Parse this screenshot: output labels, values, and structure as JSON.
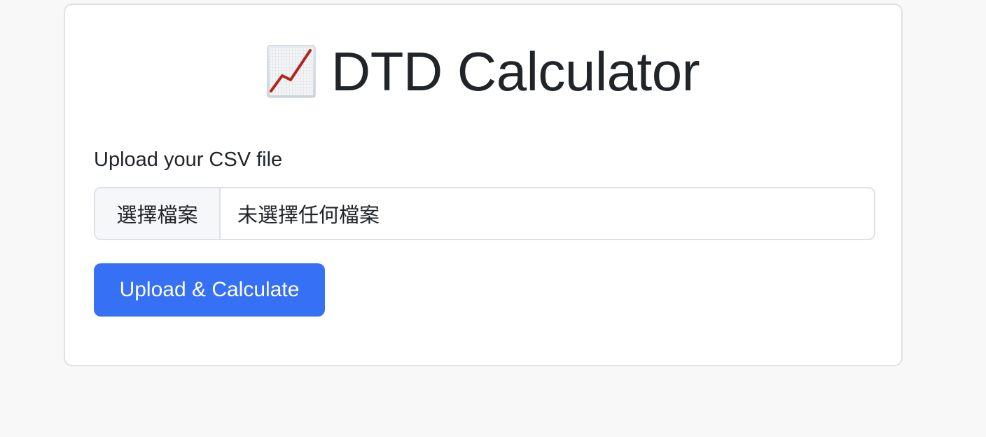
{
  "header": {
    "icon": "chart-increasing-icon",
    "title": "DTD Calculator"
  },
  "form": {
    "label": "Upload your CSV file",
    "file_input": {
      "button_label": "選擇檔案",
      "status_text": "未選擇任何檔案"
    },
    "submit_label": "Upload & Calculate"
  },
  "colors": {
    "background": "#f8f8f9",
    "card": "#ffffff",
    "primary": "#3570f5",
    "text": "#212529",
    "border": "#dee2e6",
    "chart_line": "#c0392b"
  }
}
